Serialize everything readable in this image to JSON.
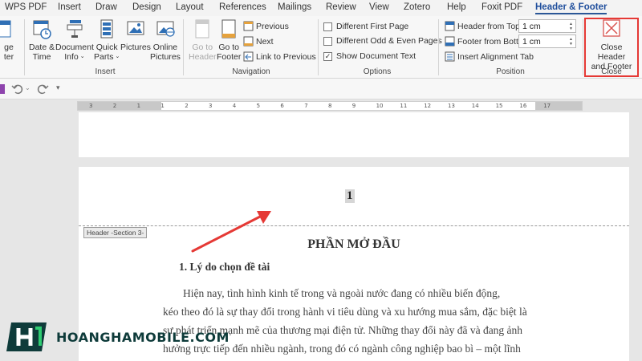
{
  "tabs": [
    "WPS PDF",
    "Insert",
    "Draw",
    "Design",
    "Layout",
    "References",
    "Mailings",
    "Review",
    "View",
    "Zotero",
    "Help",
    "Foxit PDF",
    "Header & Footer"
  ],
  "ribbon": {
    "left_cut": [
      "ge",
      "ter"
    ],
    "insert": {
      "buttons": [
        {
          "line1": "Date &",
          "line2": "Time"
        },
        {
          "line1": "Document",
          "line2": "Info"
        },
        {
          "line1": "Quick",
          "line2": "Parts"
        },
        {
          "line1": "Pictures",
          "line2": ""
        },
        {
          "line1": "Online",
          "line2": "Pictures"
        }
      ],
      "label": "Insert"
    },
    "navigation": {
      "goto_header": {
        "line1": "Go to",
        "line2": "Header"
      },
      "goto_footer": {
        "line1": "Go to",
        "line2": "Footer"
      },
      "previous": "Previous",
      "next": "Next",
      "link_previous": "Link to Previous",
      "label": "Navigation"
    },
    "options": {
      "different_first_page": "Different First Page",
      "different_odd_even": "Different Odd & Even Pages",
      "show_document_text": "Show Document Text",
      "label": "Options"
    },
    "position": {
      "header_from_top": "Header from Top:",
      "header_from_top_value": "1 cm",
      "footer_from_bottom": "Footer from Bottom:",
      "footer_from_bottom_value": "1 cm",
      "insert_alignment_tab": "Insert Alignment Tab",
      "label": "Position"
    },
    "close": {
      "line1": "Close Header",
      "line2": "and Footer",
      "label": "Close"
    }
  },
  "ruler": {
    "numbers": [
      "3",
      "2",
      "1",
      "1",
      "2",
      "3",
      "4",
      "5",
      "6",
      "7",
      "8",
      "9",
      "10",
      "11",
      "12",
      "13",
      "14",
      "15",
      "16",
      "17"
    ]
  },
  "document": {
    "page_number": "1",
    "header_tag": "Header -Section 3-",
    "title": "PHẦN MỞ ĐẦU",
    "heading": "1.   Lý do chọn đề tài",
    "paragraph_lines": [
      "Hiện nay, tình hình kinh tế trong và ngoài nước đang có nhiều biến động,",
      "kéo theo đó là sự thay đổi trong hành vi tiêu dùng và xu hướng mua sắm, đặc biệt là",
      "sự phát triển mạnh mẽ của thương mại điện tử. Những thay đổi này đã và đang ảnh",
      "hưởng trực tiếp đến nhiều ngành, trong đó có ngành công nghiệp bao bì – một lĩnh"
    ]
  },
  "watermark": {
    "text": "HOANGHAMOBILE.COM"
  },
  "colors": {
    "highlight_red": "#e53935",
    "active_tab": "#1f4e9c",
    "logo": "#0e3b3a"
  }
}
